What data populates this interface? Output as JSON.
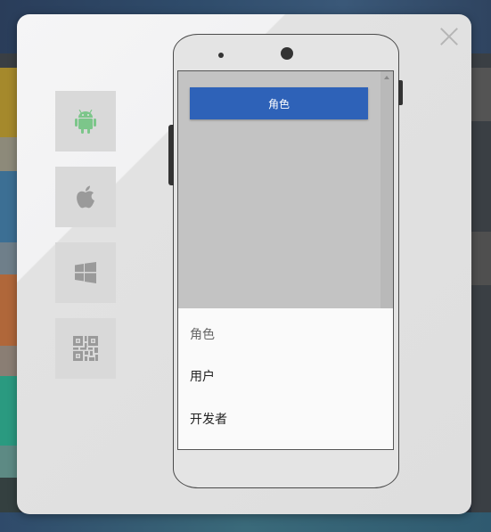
{
  "dialog": {
    "close_icon": "close-icon"
  },
  "os_tabs": [
    {
      "name": "android",
      "icon": "android-icon",
      "color": "#7cc68a"
    },
    {
      "name": "apple",
      "icon": "apple-icon",
      "color": "#9a9a9a"
    },
    {
      "name": "windows",
      "icon": "windows-icon",
      "color": "#9a9a9a"
    },
    {
      "name": "qrcode",
      "icon": "qrcode-icon",
      "color": "#9a9a9a"
    }
  ],
  "phone_screen": {
    "select_button_label": "角色",
    "picker": {
      "title": "角色",
      "options": [
        "用户",
        "开发者"
      ]
    },
    "accent_color": "#2e62b8"
  }
}
